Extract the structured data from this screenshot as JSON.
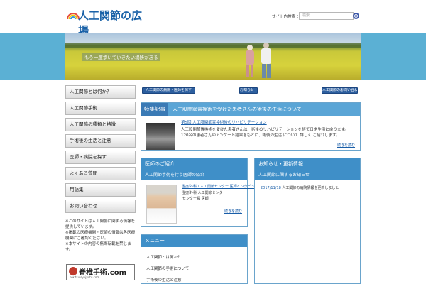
{
  "header": {
    "logo_text": "人工関節の広場",
    "search_label": "サイト内検索 ：",
    "search_placeholder": "検索"
  },
  "hero": {
    "caption": "もう一度歩いていきたい場所がある"
  },
  "sidebar": {
    "items": [
      {
        "label": "人工関節とは何か？"
      },
      {
        "label": "人工関節手術"
      },
      {
        "label": "人工関節の種類と特徴"
      },
      {
        "label": "手術後の生活と注意"
      },
      {
        "label": "医師・病院を探す"
      },
      {
        "label": "よくある質問"
      },
      {
        "label": "用語集"
      },
      {
        "label": "お問い合わせ"
      }
    ],
    "notes": [
      "※このサイトは人工関節に関する情報を提供しています。",
      "※掲載の医療機関・医師の情報は各医療機関にご確認ください。",
      "※本サイトの内容の無断転載を禁じます。"
    ],
    "banner": {
      "text": "脊椎手術.com",
      "url": "sekitsuisyujyutu.com"
    }
  },
  "nav": {
    "buttons": [
      {
        "label": "人工関節の病院・医師を探す"
      },
      {
        "label": "お知らせ一覧"
      },
      {
        "label": "人工関節のお問い合わせ"
      }
    ]
  },
  "featured": {
    "tag": "特集記事",
    "title": "人工股関節置換術を受けた患者さんの術後の生活について",
    "link": "第5回 人工股関節置換術後のリハビリテーション",
    "body": "人工股関節置換術を受けた患者さんは、術後のリハビリテーションを経て日常生活に戻ります。120名の患者さんのアンケート結果をもとに、術後の生活 について 詳しく ご紹介します。",
    "more": "続きを読む"
  },
  "doctor_panel": {
    "title": "医師のご紹介",
    "subtitle": "人工関節手術を行う医師の紹介",
    "link": "整形外科・人工関節センター 医師インタビュー",
    "line1": "整形外科 人工関節センター",
    "line2": "センター長 医師",
    "more": "続きを読む"
  },
  "news_panel": {
    "title": "お知らせ・更新情報",
    "subtitle": "人工関節に関するお知らせ",
    "items": [
      {
        "date": "2017/11/18",
        "text": " 人工関節の病院情報を更新しました"
      }
    ]
  },
  "menu_panel": {
    "title": "メニュー",
    "items": [
      {
        "label": "人工関節とは何か？"
      },
      {
        "label": "人工関節の手術について"
      },
      {
        "label": "手術後の生活と注意"
      }
    ]
  },
  "colors": {
    "band": "#5bb0d4",
    "panel_header": "#3f8fc8",
    "nav_button": "#2d5f9f",
    "link": "#1a5ea8"
  }
}
